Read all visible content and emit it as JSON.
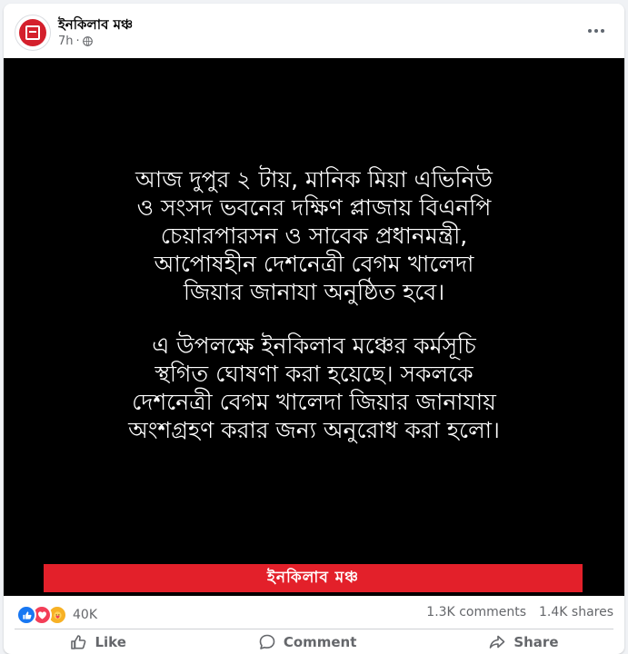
{
  "post": {
    "page_name": "ইনকিলাব মঞ্চ",
    "time": "7h",
    "separator": "·",
    "audience_icon": "globe-icon",
    "more_icon": "more-options-icon"
  },
  "image": {
    "paragraph1": [
      "আজ দুপুর ২ টায়, মানিক মিয়া এভিনিউ",
      "ও সংসদ ভবনের দক্ষিণ প্লাজায় বিএনপি",
      "চেয়ারপারসন ও সাবেক প্রধানমন্ত্রী,",
      "আপোষহীন দেশনেত্রী বেগম খালেদা",
      "জিয়ার জানাযা অনুষ্ঠিত হবে।"
    ],
    "paragraph2": [
      "এ উপলক্ষে ইনকিলাব মঞ্চের কর্মসূচি",
      "স্থগিত ঘোষণা করা হয়েছে। সকলকে",
      "দেশনেত্রী বেগম খালেদা জিয়ার জানাযায়",
      "অংশগ্রহণ করার জন্য অনুরোধ করা হলো।"
    ],
    "banner_text": "ইনকিলাব মঞ্চ",
    "banner_color": "#e3202a"
  },
  "stats": {
    "reaction_count": "40K",
    "reactions": [
      "like-icon",
      "love-icon",
      "care-icon"
    ],
    "comments": "1.3K comments",
    "shares": "1.4K shares"
  },
  "actions": {
    "like": "Like",
    "comment": "Comment",
    "share": "Share"
  },
  "colors": {
    "accent": "#1877f2",
    "secondary_text": "#65676b"
  }
}
